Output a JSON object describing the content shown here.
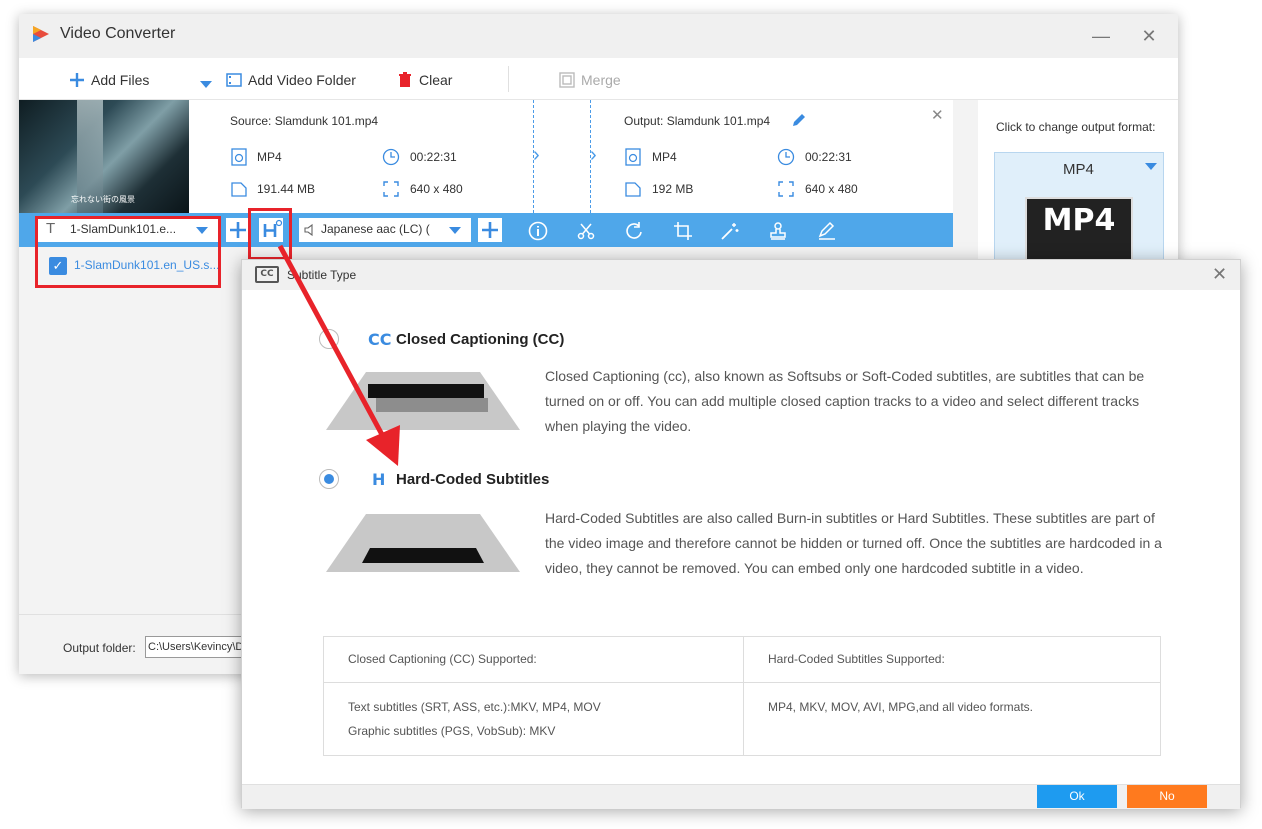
{
  "window": {
    "title": "Video Converter",
    "minimize": "—",
    "close": "✕"
  },
  "toolbar": {
    "add_files": "Add Files",
    "add_video_folder": "Add Video Folder",
    "clear": "Clear",
    "merge": "Merge"
  },
  "task": {
    "thumbnail_caption": "忘れない街の風景",
    "source_label": "Source: Slamdunk 101.mp4",
    "output_label": "Output: Slamdunk 101.mp4",
    "source": {
      "format": "MP4",
      "duration": "00:22:31",
      "size": "191.44 MB",
      "resolution": "640 x 480"
    },
    "output": {
      "format": "MP4",
      "duration": "00:22:31",
      "size": "192 MB",
      "resolution": "640 x 480"
    },
    "remove": "✕"
  },
  "format_panel": {
    "caption": "Click to change output format:",
    "selected": "MP4",
    "icon_text": "MP4"
  },
  "bar": {
    "subtitle_select": "1-SlamDunk101.e...",
    "audio_select": "Japanese aac (LC) ("
  },
  "subtitle_list": {
    "item": "1-SlamDunk101.en_US.s..."
  },
  "output_folder": {
    "label": "Output folder:",
    "value": "C:\\Users\\Kevincy\\D"
  },
  "dialog": {
    "title": "Subtitle Type",
    "close": "✕",
    "cc": {
      "icon": "CC",
      "title": "Closed Captioning (CC)",
      "desc": "Closed Captioning (cc), also known as Softsubs or Soft-Coded subtitles, are subtitles that can be turned on or off. You can add multiple closed caption tracks to a video and select different tracks when playing the video."
    },
    "hard": {
      "icon": "H",
      "title": "Hard-Coded Subtitles",
      "desc": "Hard-Coded Subtitles are also called Burn-in subtitles or Hard Subtitles. These subtitles are part of the video image and therefore cannot be hidden or turned off. Once the subtitles are hardcoded in a video, they cannot be removed. You can embed only one hardcoded subtitle in a video."
    },
    "selected": "hard",
    "table": {
      "cc_header": "Closed Captioning (CC) Supported:",
      "hard_header": "Hard-Coded Subtitles Supported:",
      "cc_line1": "Text subtitles (SRT, ASS, etc.):MKV, MP4, MOV",
      "cc_line2": "Graphic subtitles (PGS, VobSub): MKV",
      "hard_line1": "MP4, MKV, MOV, AVI, MPG,and all video formats."
    },
    "ok": "Ok",
    "no": "No"
  },
  "colors": {
    "accent": "#3a8be0",
    "bar_blue": "#4fa7ea",
    "highlight_red": "#e8232a",
    "ok_blue": "#1e9bf0",
    "no_orange": "#ff7a1e"
  }
}
